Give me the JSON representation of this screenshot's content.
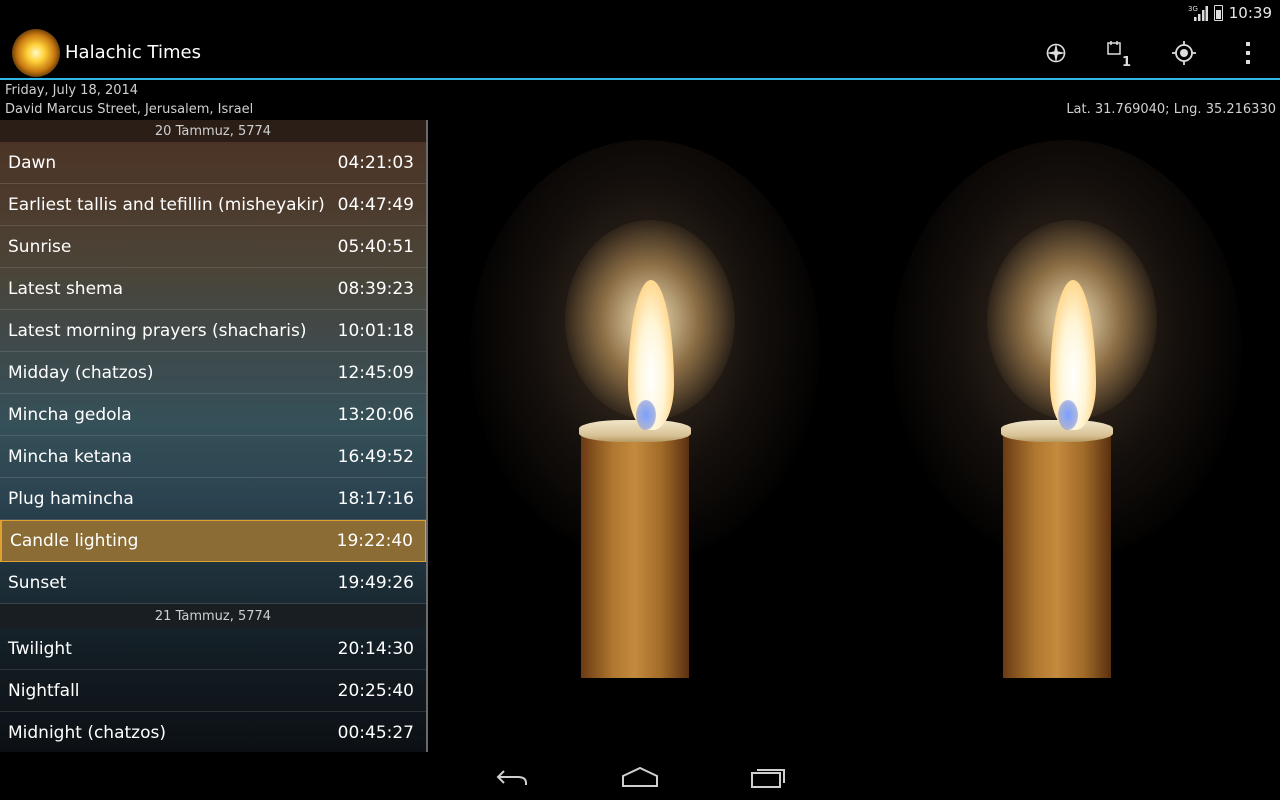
{
  "status_bar": {
    "network": "3G",
    "time": "10:39",
    "icons": [
      "signal-icon",
      "battery-icon"
    ]
  },
  "action_bar": {
    "title": "Halachic Times",
    "actions": [
      "compass-icon",
      "calendar-date-icon",
      "my-location-icon",
      "overflow-menu-icon"
    ],
    "calendar_day": "1",
    "accent_color": "#33b5e5"
  },
  "header": {
    "date": "Friday, July 18, 2014",
    "location": "David Marcus Street, Jerusalem, Israel",
    "coordinates": "Lat. 31.769040; Lng. 35.216330"
  },
  "list": {
    "hebrew_date_1": "20 Tammuz, 5774",
    "items_day1": [
      {
        "label": "Dawn",
        "time": "04:21:03"
      },
      {
        "label": "Earliest tallis and tefillin (misheyakir)",
        "time": "04:47:49"
      },
      {
        "label": "Sunrise",
        "time": "05:40:51"
      },
      {
        "label": "Latest shema",
        "time": "08:39:23"
      },
      {
        "label": "Latest morning prayers (shacharis)",
        "time": "10:01:18"
      },
      {
        "label": "Midday (chatzos)",
        "time": "12:45:09"
      },
      {
        "label": "Mincha gedola",
        "time": "13:20:06"
      },
      {
        "label": "Mincha ketana",
        "time": "16:49:52"
      },
      {
        "label": "Plug hamincha",
        "time": "18:17:16"
      },
      {
        "label": "Candle lighting",
        "time": "19:22:40"
      },
      {
        "label": "Sunset",
        "time": "19:49:26"
      }
    ],
    "hebrew_date_2": "21 Tammuz, 5774",
    "items_day2": [
      {
        "label": "Twilight",
        "time": "20:14:30"
      },
      {
        "label": "Nightfall",
        "time": "20:25:40"
      },
      {
        "label": "Midnight (chatzos)",
        "time": "00:45:27"
      }
    ],
    "highlight_color": "#8a6c34"
  },
  "nav_bar": {
    "buttons": [
      "back-icon",
      "home-icon",
      "recent-apps-icon"
    ]
  }
}
